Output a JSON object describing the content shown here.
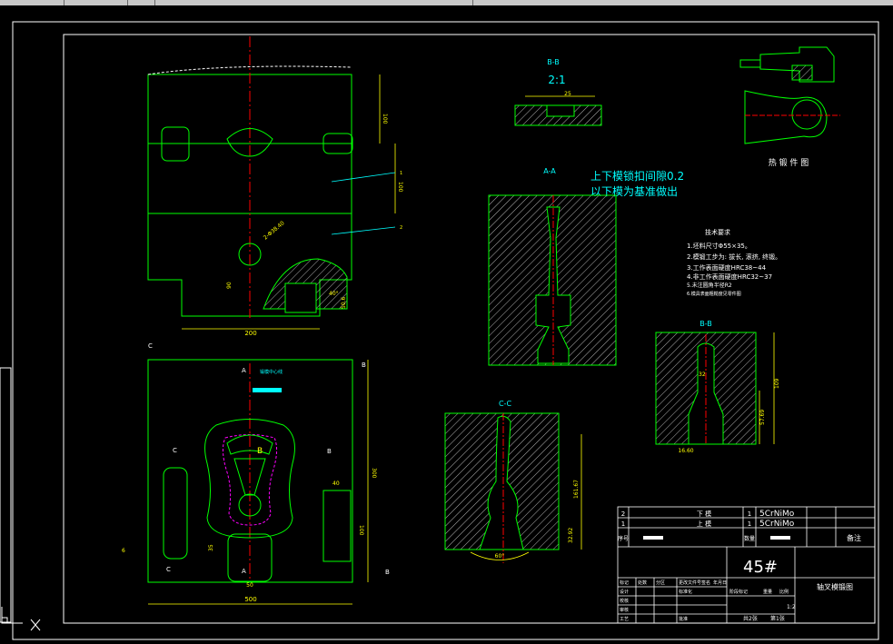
{
  "drawing": {
    "section_bb_top": {
      "title": "B-B",
      "scale": "2:1",
      "dim": "25"
    },
    "heat_part_caption": "热 锻 件 图",
    "section_aa": {
      "title": "A-A",
      "note_line1": "上下模锁扣间隙0.2",
      "note_line2": "以下模为基准做出"
    },
    "tech_req": {
      "title": "技术要求",
      "items": [
        "1.坯料尺寸Φ55×35。",
        "2.模锻工步为: 拔长, 滚挤, 终锻。",
        "3.工作表面硬度HRC38~44",
        "4.非工作表面硬度HRC32~37",
        "5.未注圆角半径R2",
        "6.模具表面粗糙度见零件图"
      ]
    },
    "section_bb_right": {
      "title": "B-B",
      "dim_height": "109",
      "dim_mid": "57.69",
      "dim_bottom": "16.60",
      "dim_top": "32"
    },
    "section_cc": {
      "title": "C-C",
      "dim_height": "161.67",
      "dim_bottom": "32.92",
      "angle": "60°"
    },
    "top_view": {
      "dim_width": "200",
      "dim_right_1": "100",
      "dim_right_2": "100",
      "dim_left": "90",
      "radius": "2-Φ38.40",
      "callout_1": "1",
      "callout_2": "2",
      "dim_small": "50.6",
      "angle": "40°"
    },
    "bottom_view": {
      "dim_width": "500",
      "dim_height": "300",
      "dim_side": "100",
      "dim_base": "50",
      "dim_35": "35",
      "dim_40": "40",
      "dim_6": "6",
      "label_a": "A",
      "label_b": "B",
      "label_c": "C",
      "note": "锻模中心线"
    }
  },
  "title_block": {
    "rows": [
      {
        "no": "2",
        "name": "下    模",
        "qty": "1",
        "material": "5CrNiMo"
      },
      {
        "no": "1",
        "name": "上    模",
        "qty": "1",
        "material": "5CrNiMo"
      }
    ],
    "header_no": "序号",
    "header_qty": "数量",
    "header_remark": "备注",
    "material_big": "45#",
    "part_name": "轴叉模锻图",
    "sheets_total": "共2张",
    "sheet_no": "第1张",
    "scale": "1:2",
    "labels": [
      "标记",
      "处数",
      "分区",
      "更改文件号",
      "签名",
      "年月日",
      "设计",
      "标准化",
      "阶段标记",
      "重量",
      "比例",
      "校核",
      "审核",
      "工艺",
      "批准"
    ]
  },
  "colors": {
    "frame": "#ffffff",
    "outline_green": "#00ff00",
    "center_red": "#ff0000",
    "dim_yellow": "#ffff00",
    "text_cyan": "#00ffff",
    "magenta": "#ff00ff"
  }
}
